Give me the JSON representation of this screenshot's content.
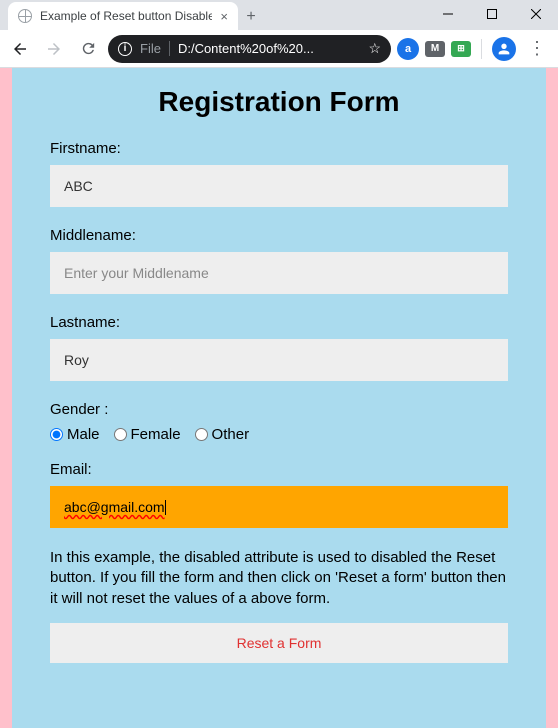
{
  "browser": {
    "tab_title": "Example of Reset button Disable",
    "url_scheme": "File",
    "url_path": "D:/Content%20of%20...",
    "newtab_label": "+",
    "close_tab": "×"
  },
  "page": {
    "title": "Registration Form",
    "firstname_label": "Firstname:",
    "firstname_value": "ABC",
    "middlename_label": "Middlename:",
    "middlename_placeholder": "Enter your Middlename",
    "lastname_label": "Lastname:",
    "lastname_value": "Roy",
    "gender_label": "Gender :",
    "gender_options": {
      "male": "Male",
      "female": "Female",
      "other": "Other"
    },
    "gender_selected": "male",
    "email_label": "Email:",
    "email_value": "abc@gmail.com",
    "description": "In this example, the disabled attribute is used to disabled the Reset button. If you fill the form and then click on 'Reset a form' button then it will not reset the values of a above form.",
    "reset_button": "Reset a Form"
  }
}
